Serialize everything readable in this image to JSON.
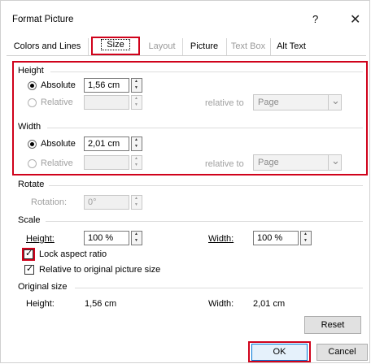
{
  "window": {
    "title": "Format Picture",
    "help": "?",
    "close": "✕"
  },
  "tabs": [
    {
      "label": "Colors and Lines"
    },
    {
      "label": "Size"
    },
    {
      "label": "Layout"
    },
    {
      "label": "Picture"
    },
    {
      "label": "Text Box"
    },
    {
      "label": "Alt Text"
    }
  ],
  "height": {
    "label": "Height",
    "absolute_label": "Absolute",
    "absolute_value": "1,56 cm",
    "relative_label": "Relative",
    "relative_to_label": "relative to",
    "relative_to_value": "Page"
  },
  "width": {
    "label": "Width",
    "absolute_label": "Absolute",
    "absolute_value": "2,01 cm",
    "relative_label": "Relative",
    "relative_to_label": "relative to",
    "relative_to_value": "Page"
  },
  "rotate": {
    "label": "Rotate",
    "rotation_label": "Rotation:",
    "rotation_value": "0°"
  },
  "scale": {
    "label": "Scale",
    "height_label": "Height:",
    "height_value": "100 %",
    "width_label": "Width:",
    "width_value": "100 %",
    "lock_label": "Lock aspect ratio",
    "relative_label": "Relative to original picture size"
  },
  "original": {
    "label": "Original size",
    "height_label": "Height:",
    "height_value": "1,56 cm",
    "width_label": "Width:",
    "width_value": "2,01 cm",
    "reset_label": "Reset"
  },
  "buttons": {
    "ok": "OK",
    "cancel": "Cancel"
  },
  "colors": {
    "highlight": "#d0021b"
  }
}
